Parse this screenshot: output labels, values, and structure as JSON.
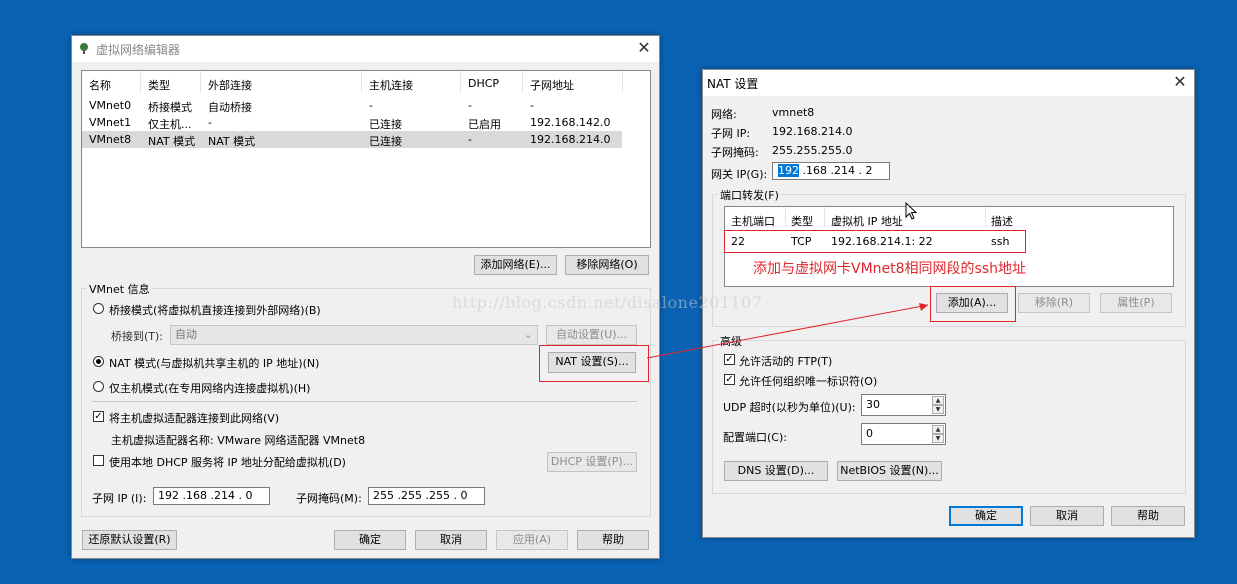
{
  "vne": {
    "title": "虚拟网络编辑器",
    "table": {
      "headers": [
        "名称",
        "类型",
        "外部连接",
        "主机连接",
        "DHCP",
        "子网地址"
      ],
      "rows": [
        [
          "VMnet0",
          "桥接模式",
          "自动桥接",
          "-",
          "-",
          "-"
        ],
        [
          "VMnet1",
          "仅主机...",
          "-",
          "已连接",
          "已启用",
          "192.168.142.0"
        ],
        [
          "VMnet8",
          "NAT 模式",
          "NAT 模式",
          "已连接",
          "-",
          "192.168.214.0"
        ]
      ]
    },
    "add_network": "添加网络(E)...",
    "remove_network": "移除网络(O)",
    "vmnet_info": "VMnet 信息",
    "bridged_label": "桥接模式(将虚拟机直接连接到外部网络)(B)",
    "bridged_to_label": "桥接到(T):",
    "bridged_to_value": "自动",
    "auto_settings": "自动设置(U)...",
    "nat_label": "NAT 模式(与虚拟机共享主机的 IP 地址)(N)",
    "nat_settings": "NAT 设置(S)...",
    "hostonly_label": "仅主机模式(在专用网络内连接虚拟机)(H)",
    "connect_adapter": "将主机虚拟适配器连接到此网络(V)",
    "adapter_name": "主机虚拟适配器名称: VMware 网络适配器 VMnet8",
    "use_dhcp": "使用本地 DHCP 服务将 IP 地址分配给虚拟机(D)",
    "dhcp_settings": "DHCP 设置(P)...",
    "subnet_ip_label": "子网 IP (I):",
    "subnet_ip_value": "192 .168 .214 .  0",
    "subnet_mask_label": "子网掩码(M):",
    "subnet_mask_value": "255 .255 .255 .  0",
    "restore_defaults": "还原默认设置(R)",
    "ok": "确定",
    "cancel": "取消",
    "apply": "应用(A)",
    "help": "帮助"
  },
  "nat": {
    "title": "NAT 设置",
    "network_label": "网络:",
    "network_value": "vmnet8",
    "subnet_ip_label": "子网 IP:",
    "subnet_ip_value": "192.168.214.0",
    "subnet_mask_label": "子网掩码:",
    "subnet_mask_value": "255.255.255.0",
    "gateway_label": "网关 IP(G):",
    "gateway_first": "192",
    "gateway_rest": " .168 .214 .  2",
    "port_forward_label": "端口转发(F)",
    "pf_headers": [
      "主机端口",
      "类型",
      "虚拟机 IP 地址",
      "描述"
    ],
    "pf_rows": [
      [
        "22",
        "TCP",
        "192.168.214.1: 22",
        "ssh"
      ]
    ],
    "annotation": "添加与虚拟网卡VMnet8相同网段的ssh地址",
    "add": "添加(A)...",
    "remove": "移除(R)",
    "properties": "属性(P)",
    "advanced": "高级",
    "allow_ftp": "允许活动的 FTP(T)",
    "allow_oui": "允许任何组织唯一标识符(O)",
    "udp_timeout_label": "UDP 超时(以秒为单位)(U):",
    "udp_timeout_value": "30",
    "config_port_label": "配置端口(C):",
    "config_port_value": "0",
    "dns_settings": "DNS 设置(D)...",
    "netbios_settings": "NetBIOS 设置(N)...",
    "ok": "确定",
    "cancel": "取消",
    "help": "帮助"
  },
  "watermark": "http://blog.csdn.net/disalone201107",
  "colors": {
    "desktop": "#0a62b4",
    "annotation_red": "#e0262c",
    "selection_blue": "#0078d7"
  }
}
